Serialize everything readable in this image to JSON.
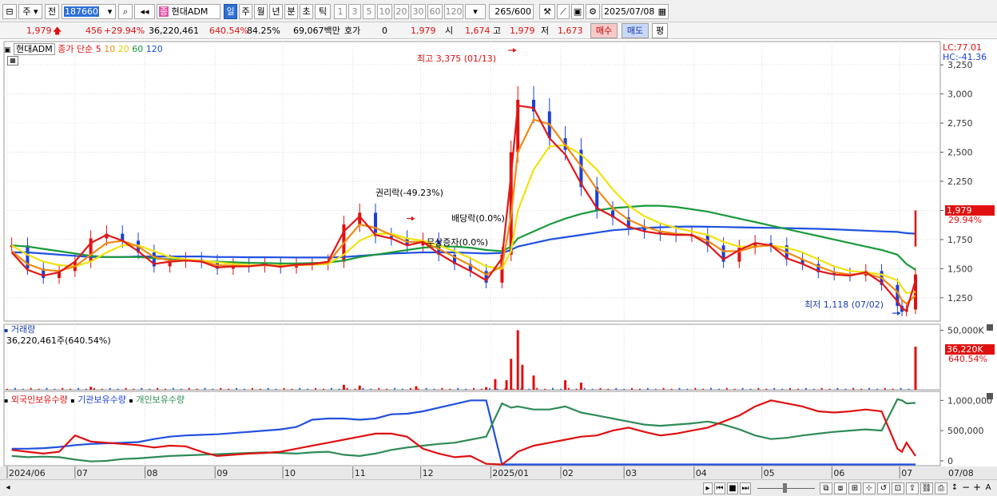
{
  "toolbar": {
    "market_label": "주",
    "prev_label": "전",
    "stock_code": "187660",
    "stock_name_icon": "종",
    "stock_name": "현대ADM",
    "periods": [
      "일",
      "주",
      "월",
      "년",
      "분",
      "초",
      "틱"
    ],
    "active_period": "일",
    "intervals": [
      "1",
      "3",
      "5",
      "10",
      "20",
      "30",
      "60",
      "120"
    ],
    "count_value": "265",
    "count_total": "/600",
    "date_value": "2025/07/08"
  },
  "info": {
    "price": "1,979",
    "change": "456",
    "change_pct": "+29.94%",
    "volume": "36,220,461",
    "volume_pct": "640.54%",
    "ratio": "84.25%",
    "amount": "69,067백만",
    "hoga_label": "호가",
    "hoga_value": "0",
    "last_price": "1,979",
    "open_label": "시",
    "open": "1,674",
    "high_label": "고",
    "high": "1,979",
    "low_label": "저",
    "low": "1,673",
    "buy_label": "매수",
    "sell_label": "매도",
    "eval_label": "평"
  },
  "main_panel": {
    "name": "현대ADM",
    "ma_label": "종가 단순",
    "ma_periods": [
      "5",
      "10",
      "20",
      "60",
      "120"
    ],
    "ma_colors": [
      "#e01818",
      "#f08a10",
      "#f2e20a",
      "#1a9a3a",
      "#2050e0"
    ],
    "lc_label": "LC:77.01",
    "hc_label": "HC:-41.36",
    "annotation_high": "최고 3,375 (01/13)",
    "annotation_low": "최저 1,118 (07/02)",
    "annotation_rights": "권리락(-49.23%)",
    "annotation_dividend": "배당락(0.0%)",
    "annotation_bonus": "무상증자(0.0%)",
    "current_price_tag": "1,979",
    "current_pct_tag": "29.94%"
  },
  "volume_panel": {
    "title": "거래량",
    "value": "36,220,461주(640.54%)",
    "tag_value": "36,220K",
    "tag_pct": "640.54%"
  },
  "holding_panel": {
    "series": [
      "외국인보유수량",
      "기관보유수량",
      "개인보유수량"
    ],
    "colors": [
      "#e01010",
      "#2050e0",
      "#2e8b57"
    ]
  },
  "x_axis_labels": [
    "2024/06",
    "07",
    "08",
    "09",
    "10",
    "11",
    "12",
    "2025/01",
    "02",
    "03",
    "04",
    "05",
    "06",
    "07",
    "07/08"
  ],
  "chart_data": {
    "type": "line",
    "title": "현대ADM",
    "price_axis": {
      "ticks": [
        "3,250",
        "3,000",
        "2,750",
        "2,500",
        "2,250",
        "2,000",
        "1,750",
        "1,500",
        "1,250"
      ],
      "ylim": [
        1050,
        3450
      ]
    },
    "volume_axis": {
      "ticks": [
        "50,000K"
      ],
      "ylim": [
        0,
        55000
      ]
    },
    "holding_axis": {
      "ticks": [
        "1,000,000",
        "500,000",
        "0"
      ],
      "ylim": [
        -80000,
        1150000
      ]
    },
    "price_points": [
      [
        "2024/06/03",
        1700
      ],
      [
        "2024/06/10",
        1500
      ],
      [
        "2024/06/17",
        1420
      ],
      [
        "2024/06/24",
        1480
      ],
      [
        "2024/07/01",
        1560
      ],
      [
        "2024/07/08",
        1760
      ],
      [
        "2024/07/15",
        1800
      ],
      [
        "2024/07/22",
        1740
      ],
      [
        "2024/07/29",
        1640
      ],
      [
        "2024/08/05",
        1520
      ],
      [
        "2024/08/12",
        1560
      ],
      [
        "2024/08/19",
        1580
      ],
      [
        "2024/08/26",
        1560
      ],
      [
        "2024/09/02",
        1500
      ],
      [
        "2024/09/09",
        1530
      ],
      [
        "2024/09/16",
        1520
      ],
      [
        "2024/09/23",
        1540
      ],
      [
        "2024/09/30",
        1510
      ],
      [
        "2024/10/07",
        1540
      ],
      [
        "2024/10/14",
        1540
      ],
      [
        "2024/10/21",
        1560
      ],
      [
        "2024/10/28",
        1880
      ],
      [
        "2024/11/04",
        1980
      ],
      [
        "2024/11/11",
        1780
      ],
      [
        "2024/11/18",
        1760
      ],
      [
        "2024/11/25",
        1700
      ],
      [
        "2024/12/02",
        1740
      ],
      [
        "2024/12/09",
        1620
      ],
      [
        "2024/12/16",
        1540
      ],
      [
        "2024/12/23",
        1480
      ],
      [
        "2024/12/30",
        1380
      ],
      [
        "2025/01/06",
        1620
      ],
      [
        "2025/01/10",
        2500
      ],
      [
        "2025/01/13",
        2950
      ],
      [
        "2025/01/20",
        2850
      ],
      [
        "2025/01/27",
        2620
      ],
      [
        "2025/02/03",
        2520
      ],
      [
        "2025/02/10",
        2200
      ],
      [
        "2025/02/17",
        2000
      ],
      [
        "2025/02/24",
        1940
      ],
      [
        "2025/03/03",
        1850
      ],
      [
        "2025/03/10",
        1820
      ],
      [
        "2025/03/17",
        1800
      ],
      [
        "2025/03/24",
        1790
      ],
      [
        "2025/03/31",
        1790
      ],
      [
        "2025/04/07",
        1700
      ],
      [
        "2025/04/14",
        1560
      ],
      [
        "2025/04/21",
        1680
      ],
      [
        "2025/04/28",
        1720
      ],
      [
        "2025/05/05",
        1700
      ],
      [
        "2025/05/12",
        1580
      ],
      [
        "2025/05/19",
        1540
      ],
      [
        "2025/05/26",
        1470
      ],
      [
        "2025/06/02",
        1450
      ],
      [
        "2025/06/09",
        1440
      ],
      [
        "2025/06/16",
        1480
      ],
      [
        "2025/06/23",
        1360
      ],
      [
        "2025/06/30",
        1180
      ],
      [
        "2025/07/02",
        1130
      ],
      [
        "2025/07/04",
        1150
      ],
      [
        "2025/07/08",
        1450
      ]
    ],
    "ma5": [
      1640,
      1490,
      1440,
      1470,
      1560,
      1720,
      1790,
      1740,
      1650,
      1540,
      1560,
      1570,
      1560,
      1510,
      1520,
      1520,
      1535,
      1515,
      1535,
      1540,
      1560,
      1820,
      1950,
      1790,
      1760,
      1700,
      1730,
      1630,
      1550,
      1480,
      1400,
      1590,
      2300,
      2900,
      2880,
      2620,
      2480,
      2230,
      2020,
      1950,
      1860,
      1820,
      1800,
      1790,
      1790,
      1710,
      1580,
      1660,
      1720,
      1700,
      1590,
      1540,
      1480,
      1450,
      1440,
      1470,
      1380,
      1220,
      1160,
      1140,
      1400
    ],
    "ma10": [
      1650,
      1540,
      1490,
      1480,
      1520,
      1620,
      1720,
      1740,
      1690,
      1600,
      1570,
      1570,
      1565,
      1530,
      1525,
      1522,
      1530,
      1522,
      1530,
      1535,
      1550,
      1720,
      1880,
      1850,
      1790,
      1730,
      1730,
      1670,
      1600,
      1530,
      1450,
      1520,
      1950,
      2500,
      2780,
      2740,
      2560,
      2380,
      2180,
      2020,
      1920,
      1860,
      1820,
      1800,
      1790,
      1740,
      1650,
      1650,
      1690,
      1700,
      1640,
      1580,
      1520,
      1470,
      1450,
      1460,
      1420,
      1300,
      1230,
      1200,
      1270
    ],
    "ma20": [
      1700,
      1620,
      1560,
      1530,
      1520,
      1560,
      1640,
      1700,
      1700,
      1650,
      1600,
      1580,
      1570,
      1555,
      1540,
      1530,
      1530,
      1528,
      1530,
      1534,
      1540,
      1620,
      1740,
      1800,
      1800,
      1760,
      1740,
      1700,
      1650,
      1590,
      1520,
      1500,
      1650,
      2000,
      2350,
      2550,
      2560,
      2480,
      2350,
      2180,
      2040,
      1950,
      1890,
      1850,
      1820,
      1790,
      1730,
      1690,
      1690,
      1700,
      1680,
      1640,
      1580,
      1520,
      1480,
      1470,
      1450,
      1400,
      1340,
      1290,
      1300
    ],
    "ma60": [
      1700,
      1690,
      1670,
      1650,
      1630,
      1610,
      1600,
      1600,
      1600,
      1590,
      1580,
      1570,
      1565,
      1560,
      1555,
      1550,
      1548,
      1545,
      1545,
      1548,
      1552,
      1570,
      1600,
      1620,
      1640,
      1660,
      1680,
      1690,
      1690,
      1680,
      1660,
      1650,
      1690,
      1760,
      1820,
      1880,
      1930,
      1970,
      2000,
      2020,
      2030,
      2040,
      2040,
      2030,
      2010,
      1990,
      1960,
      1930,
      1900,
      1870,
      1840,
      1810,
      1780,
      1750,
      1720,
      1690,
      1660,
      1620,
      1580,
      1540,
      1490
    ],
    "ma120": [
      1640,
      1640,
      1630,
      1620,
      1610,
      1600,
      1600,
      1600,
      1605,
      1605,
      1605,
      1605,
      1605,
      1600,
      1600,
      1598,
      1598,
      1597,
      1596,
      1596,
      1596,
      1600,
      1610,
      1620,
      1630,
      1635,
      1640,
      1640,
      1640,
      1635,
      1630,
      1635,
      1660,
      1690,
      1720,
      1750,
      1770,
      1790,
      1810,
      1830,
      1840,
      1850,
      1855,
      1860,
      1862,
      1860,
      1858,
      1855,
      1852,
      1850,
      1848,
      1845,
      1842,
      1838,
      1832,
      1826,
      1820,
      1815,
      1810,
      1805,
      1800
    ],
    "volume_spikes": [
      [
        "2024/07/08",
        2500
      ],
      [
        "2024/10/28",
        4200
      ],
      [
        "2024/11/04",
        3500
      ],
      [
        "2024/11/29",
        3000
      ],
      [
        "2024/12/30",
        2200
      ],
      [
        "2025/01/03",
        9000
      ],
      [
        "2025/01/08",
        8000
      ],
      [
        "2025/01/10",
        26000
      ],
      [
        "2025/01/13",
        50000
      ],
      [
        "2025/01/15",
        21000
      ],
      [
        "2025/01/20",
        12000
      ],
      [
        "2025/02/03",
        8000
      ],
      [
        "2025/02/10",
        6000
      ],
      [
        "2025/07/08",
        36220
      ]
    ],
    "foreign_holding": [
      180000,
      150000,
      120000,
      150000,
      420000,
      320000,
      300000,
      280000,
      260000,
      220000,
      250000,
      240000,
      150000,
      80000,
      100000,
      120000,
      130000,
      150000,
      200000,
      250000,
      300000,
      350000,
      400000,
      450000,
      450000,
      400000,
      200000,
      120000,
      60000,
      80000,
      -50000,
      -60000,
      50000,
      150000,
      250000,
      300000,
      350000,
      400000,
      420000,
      500000,
      550000,
      480000,
      420000,
      450000,
      500000,
      550000,
      650000,
      750000,
      900000,
      1000000,
      950000,
      900000,
      820000,
      800000,
      820000,
      850000,
      820000,
      200000,
      150000,
      300000,
      80000
    ],
    "institution_holding": [
      200000,
      200000,
      210000,
      230000,
      260000,
      280000,
      290000,
      300000,
      310000,
      360000,
      400000,
      420000,
      430000,
      440000,
      460000,
      480000,
      500000,
      520000,
      560000,
      680000,
      700000,
      700000,
      680000,
      700000,
      770000,
      780000,
      820000,
      880000,
      940000,
      1000000,
      1000000,
      -60000,
      -60000,
      -60000,
      -60000,
      -60000,
      -60000,
      -60000,
      -60000,
      -60000,
      -60000,
      -60000,
      -60000,
      -60000,
      -60000,
      -60000,
      -60000,
      -60000,
      -60000,
      -60000,
      -60000,
      -60000,
      -60000,
      -60000,
      -60000,
      -60000,
      -60000,
      -60000,
      -60000,
      -60000,
      -60000
    ],
    "individual_holding": [
      80000,
      60000,
      70000,
      60000,
      20000,
      -10000,
      0,
      30000,
      40000,
      60000,
      80000,
      90000,
      100000,
      110000,
      120000,
      130000,
      140000,
      130000,
      120000,
      140000,
      150000,
      100000,
      80000,
      120000,
      180000,
      220000,
      250000,
      280000,
      300000,
      350000,
      400000,
      950000,
      880000,
      900000,
      850000,
      850000,
      900000,
      800000,
      750000,
      700000,
      650000,
      600000,
      580000,
      600000,
      620000,
      650000,
      600000,
      520000,
      420000,
      360000,
      380000,
      420000,
      450000,
      480000,
      500000,
      520000,
      500000,
      1020000,
      1000000,
      950000,
      960000
    ]
  }
}
